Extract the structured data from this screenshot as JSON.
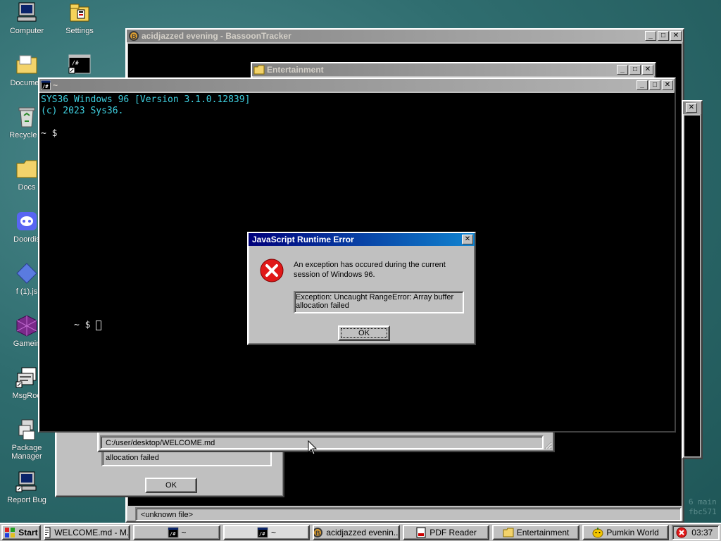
{
  "desktop_icons": [
    {
      "label": "Computer",
      "icon": "computer-icon"
    },
    {
      "label": "Settings",
      "icon": "settings-icon"
    },
    {
      "label": "Documen",
      "icon": "documents-folder-icon"
    },
    {
      "label": "",
      "icon": "terminal-shortcut-icon"
    },
    {
      "label": "Recycle B",
      "icon": "recycle-bin-icon"
    },
    {
      "label": "Docs",
      "icon": "folder-icon"
    },
    {
      "label": "Doordis",
      "icon": "discord-icon"
    },
    {
      "label": "f (1).js",
      "icon": "js-diamond-icon"
    },
    {
      "label": "Gamein",
      "icon": "gamein-cube-icon"
    },
    {
      "label": "MsgRoo",
      "icon": "msgroom-icon"
    },
    {
      "label": "Package\nManager",
      "icon": "package-manager-icon"
    },
    {
      "label": "Report Bug",
      "icon": "report-bug-icon"
    }
  ],
  "tracker_window": {
    "title": "acidjazzed evening - BassoonTracker",
    "faded_text": "6 main\nfbc571"
  },
  "entertainment_window": {
    "title": "Entertainment"
  },
  "terminal_window": {
    "title": "~",
    "lines": [
      "SYS36 Windows 96 [Version 3.1.0.12839]",
      "(c) 2023 Sys36.",
      "",
      "~ $"
    ],
    "prompt": "~ $ "
  },
  "welcome_window": {
    "path": "C:/user/desktop/WELCOME.md"
  },
  "back_error": {
    "text": "allocation failed",
    "ok_label": "OK"
  },
  "status_unknown": "<unknown file>",
  "error_dialog": {
    "title": "JavaScript Runtime Error",
    "message": "An exception has occured during the current session of Windows 96.",
    "detail": "Exception: Uncaught RangeError: Array buffer allocation failed",
    "ok_label": "OK"
  },
  "taskbar": {
    "start_label": "Start",
    "tasks": [
      {
        "label": "WELCOME.md - M...",
        "icon": "document-icon"
      },
      {
        "label": "~",
        "icon": "terminal-icon"
      },
      {
        "label": "~",
        "icon": "terminal-icon"
      },
      {
        "label": "acidjazzed evenin...",
        "icon": "bassoon-tracker-icon"
      },
      {
        "label": "PDF Reader",
        "icon": "pdf-icon"
      },
      {
        "label": "Entertainment",
        "icon": "folder-icon"
      },
      {
        "label": "Pumkin World",
        "icon": "pumpkin-icon"
      }
    ],
    "clock": "03:37"
  },
  "colors": {
    "accent": "#00007b",
    "terminal_text": "#3fd0e0",
    "desktop": "#2f6d6f"
  }
}
